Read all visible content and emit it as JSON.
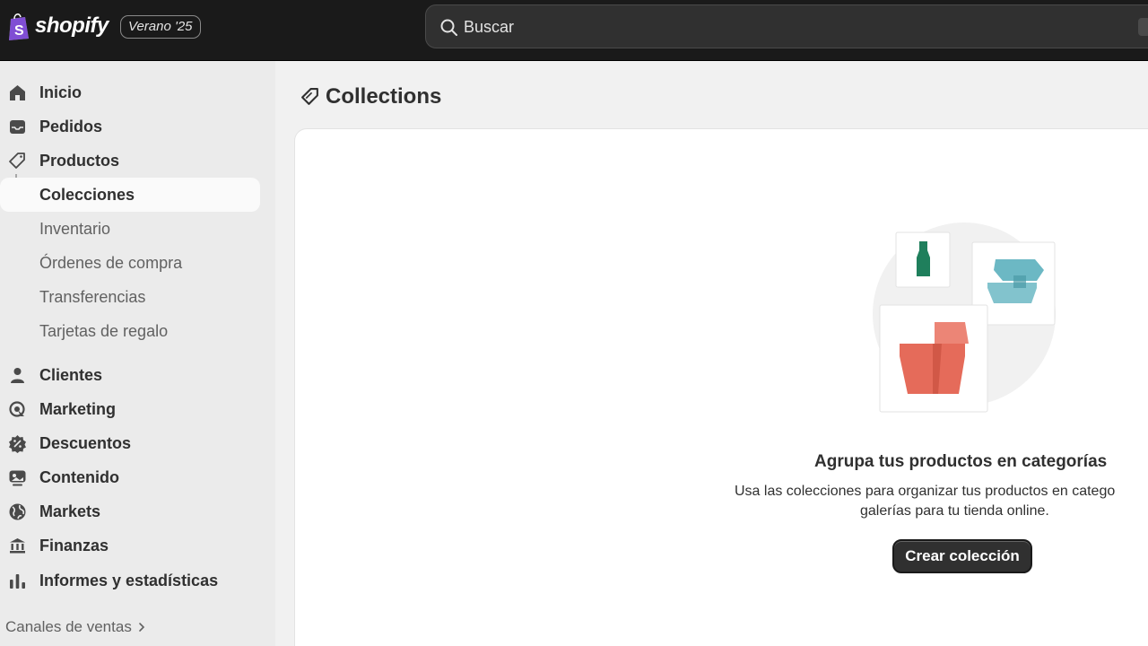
{
  "brand": {
    "name": "shopify",
    "version_badge": "Verano '25"
  },
  "search": {
    "placeholder": "Buscar"
  },
  "sidebar": {
    "items": [
      {
        "label": "Inicio",
        "icon": "home-icon"
      },
      {
        "label": "Pedidos",
        "icon": "inbox-icon"
      },
      {
        "label": "Productos",
        "icon": "tag-icon"
      },
      {
        "label": "Colecciones",
        "active": true
      },
      {
        "label": "Inventario"
      },
      {
        "label": "Órdenes de compra"
      },
      {
        "label": "Transferencias"
      },
      {
        "label": "Tarjetas de regalo"
      },
      {
        "label": "Clientes",
        "icon": "person-icon"
      },
      {
        "label": "Marketing",
        "icon": "target-icon"
      },
      {
        "label": "Descuentos",
        "icon": "discount-icon"
      },
      {
        "label": "Contenido",
        "icon": "content-icon"
      },
      {
        "label": "Markets",
        "icon": "globe-icon"
      },
      {
        "label": "Finanzas",
        "icon": "bank-icon"
      },
      {
        "label": "Informes y estadísticas",
        "icon": "chart-bar-icon"
      }
    ],
    "channels_label": "Canales de ventas"
  },
  "main": {
    "title": "Collections",
    "empty_state": {
      "heading": "Agrupa tus productos en categorías",
      "body_line1": "Usa las colecciones para organizar tus productos en catego",
      "body_line2": "galerías para tu tienda online.",
      "button": "Crear colección"
    }
  },
  "colors": {
    "topbar": "#1a1a1a",
    "sidebar": "#ebebeb",
    "accent_green": "#1f7f5c",
    "accent_teal": "#6cb8c4",
    "accent_coral": "#e56b5a"
  }
}
